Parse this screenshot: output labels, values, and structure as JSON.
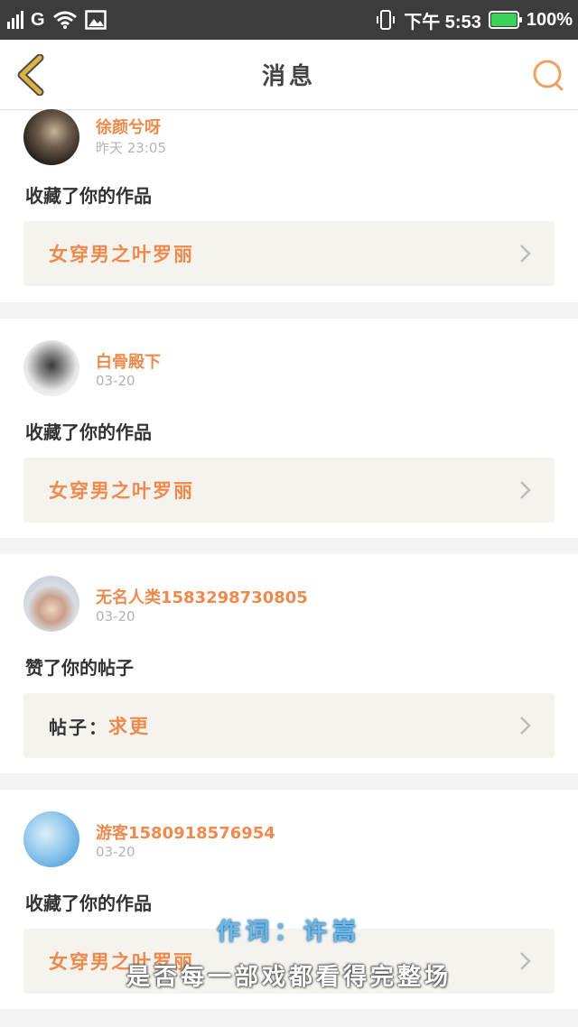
{
  "status_bar": {
    "carrier": "G",
    "time": "下午 5:53",
    "battery": "100%",
    "battery_level": 1.0
  },
  "header": {
    "title": "消息"
  },
  "colors": {
    "accent": "#ee8a4e",
    "back_icon": "#e0b341",
    "search_icon": "#f0a060"
  },
  "messages": [
    {
      "username": "徐颜兮呀",
      "date": "昨天 23:05",
      "action": "收藏了你的作品",
      "target_label": "",
      "target": "女穿男之叶罗丽"
    },
    {
      "username": "白骨殿下",
      "date": "03-20",
      "action": "收藏了你的作品",
      "target_label": "",
      "target": "女穿男之叶罗丽"
    },
    {
      "username": "无名人类1583298730805",
      "date": "03-20",
      "action": "赞了你的帖子",
      "target_label": "帖子：",
      "target": "求更"
    },
    {
      "username": "游客1580918576954",
      "date": "03-20",
      "action": "收藏了你的作品",
      "target_label": "",
      "target": "女穿男之叶罗丽"
    }
  ],
  "subtitles": {
    "line1": "作词：许嵩",
    "line2": "是否每一部戏都看得完整场"
  }
}
